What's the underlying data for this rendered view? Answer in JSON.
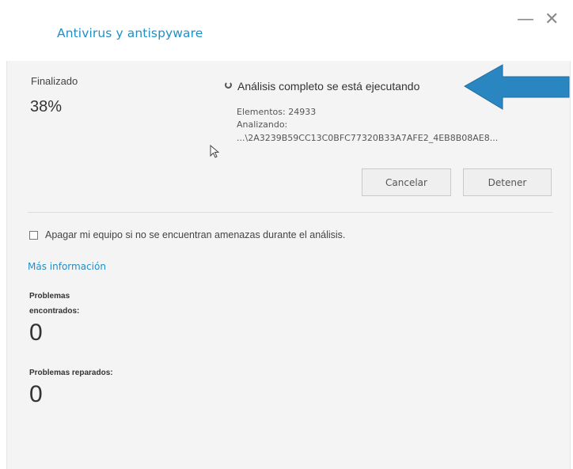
{
  "window": {
    "title": "Antivirus y antispyware",
    "minimize_label": "—",
    "close_label": "✕"
  },
  "scan": {
    "status_label": "Finalizado",
    "progress_percent": "38%",
    "title": "Análisis completo se está ejecutando",
    "elements_text": "Elementos: 24933",
    "analyzing_label": "Analizando:",
    "current_path": "...\\2A3239B59CC13C0BFC77320B33A7AFE2_4EB8B08AE8..."
  },
  "buttons": {
    "cancel_label": "Cancelar",
    "stop_label": "Detener"
  },
  "options": {
    "shutdown_label": "Apagar mi equipo si no se encuentran amenazas durante el análisis.",
    "shutdown_checked": false
  },
  "links": {
    "more_info": "Más información"
  },
  "results": {
    "found_label": "Problemas encontrados:",
    "found_value": "0",
    "repaired_label": "Problemas reparados:",
    "repaired_value": "0"
  },
  "colors": {
    "accent": "#1f8fc6",
    "arrow": "#2a86c0"
  },
  "icons": [
    "minimize-icon",
    "close-icon",
    "spinner-icon",
    "cursor-icon",
    "arrow-icon",
    "checkbox-icon"
  ]
}
